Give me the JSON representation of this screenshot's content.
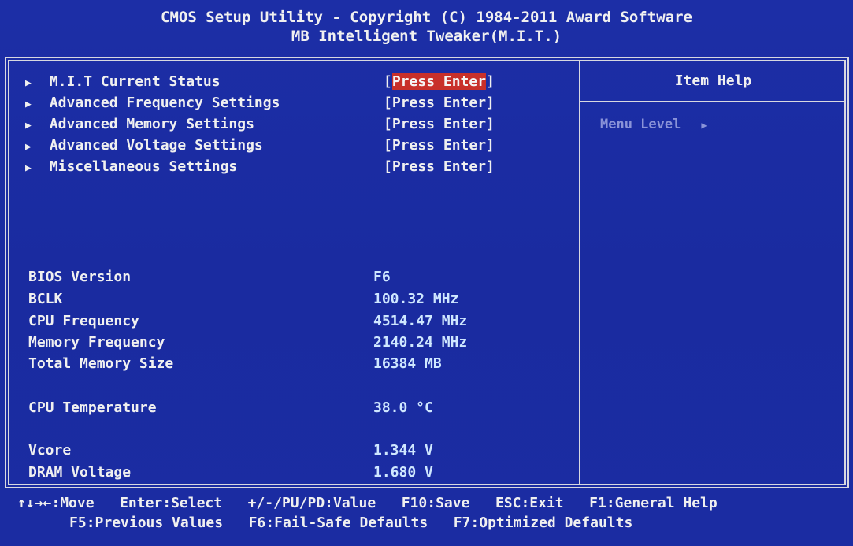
{
  "header": {
    "title_line1": "CMOS Setup Utility - Copyright (C) 1984-2011 Award Software",
    "title_line2": "MB Intelligent Tweaker(M.I.T.)"
  },
  "menu": {
    "items": [
      {
        "label": "M.I.T Current Status",
        "value_open": "[",
        "value_text": "Press Enter",
        "value_close": "]",
        "selected": true
      },
      {
        "label": "Advanced Frequency Settings",
        "value": "[Press Enter]"
      },
      {
        "label": "Advanced Memory Settings",
        "value": "[Press Enter]"
      },
      {
        "label": "Advanced Voltage Settings",
        "value": "[Press Enter]"
      },
      {
        "label": "Miscellaneous Settings",
        "value": "[Press Enter]"
      }
    ]
  },
  "info": {
    "bios_version": {
      "label": "BIOS Version",
      "value": "F6"
    },
    "bclk": {
      "label": "BCLK",
      "value": "100.32 MHz"
    },
    "cpu_frequency": {
      "label": "CPU Frequency",
      "value": "4514.47 MHz"
    },
    "memory_frequency": {
      "label": "Memory Frequency",
      "value": "2140.24 MHz"
    },
    "total_memory_size": {
      "label": "Total Memory Size",
      "value": "16384 MB"
    },
    "cpu_temperature": {
      "label": "CPU Temperature",
      "value": "38.0 °C"
    },
    "vcore": {
      "label": "Vcore",
      "value": "1.344 V"
    },
    "dram_voltage": {
      "label": "DRAM Voltage",
      "value": "1.680 V"
    }
  },
  "help": {
    "title": "Item Help",
    "menu_level_label": "Menu Level"
  },
  "footer": {
    "row1": [
      {
        "key": "↑↓→←",
        "action": ":Move"
      },
      {
        "key": "Enter",
        "action": ":Select"
      },
      {
        "key": "+/-/PU/PD",
        "action": ":Value"
      },
      {
        "key": "F10",
        "action": ":Save"
      },
      {
        "key": "ESC",
        "action": ":Exit"
      },
      {
        "key": "F1",
        "action": ":General Help"
      }
    ],
    "row2": [
      {
        "key": "F5",
        "action": ":Previous Values"
      },
      {
        "key": "F6",
        "action": ":Fail-Safe Defaults"
      },
      {
        "key": "F7",
        "action": ":Optimized Defaults"
      }
    ]
  },
  "colors": {
    "background": "#1a2ba0",
    "highlight": "#c8302a",
    "text": "#f0f0f0",
    "value_text": "#cfe7ff",
    "dim_text": "#8a93d8"
  },
  "icons": {
    "submenu_arrow": "triangle-right-icon",
    "menu_level_arrow": "triangle-right-icon"
  }
}
